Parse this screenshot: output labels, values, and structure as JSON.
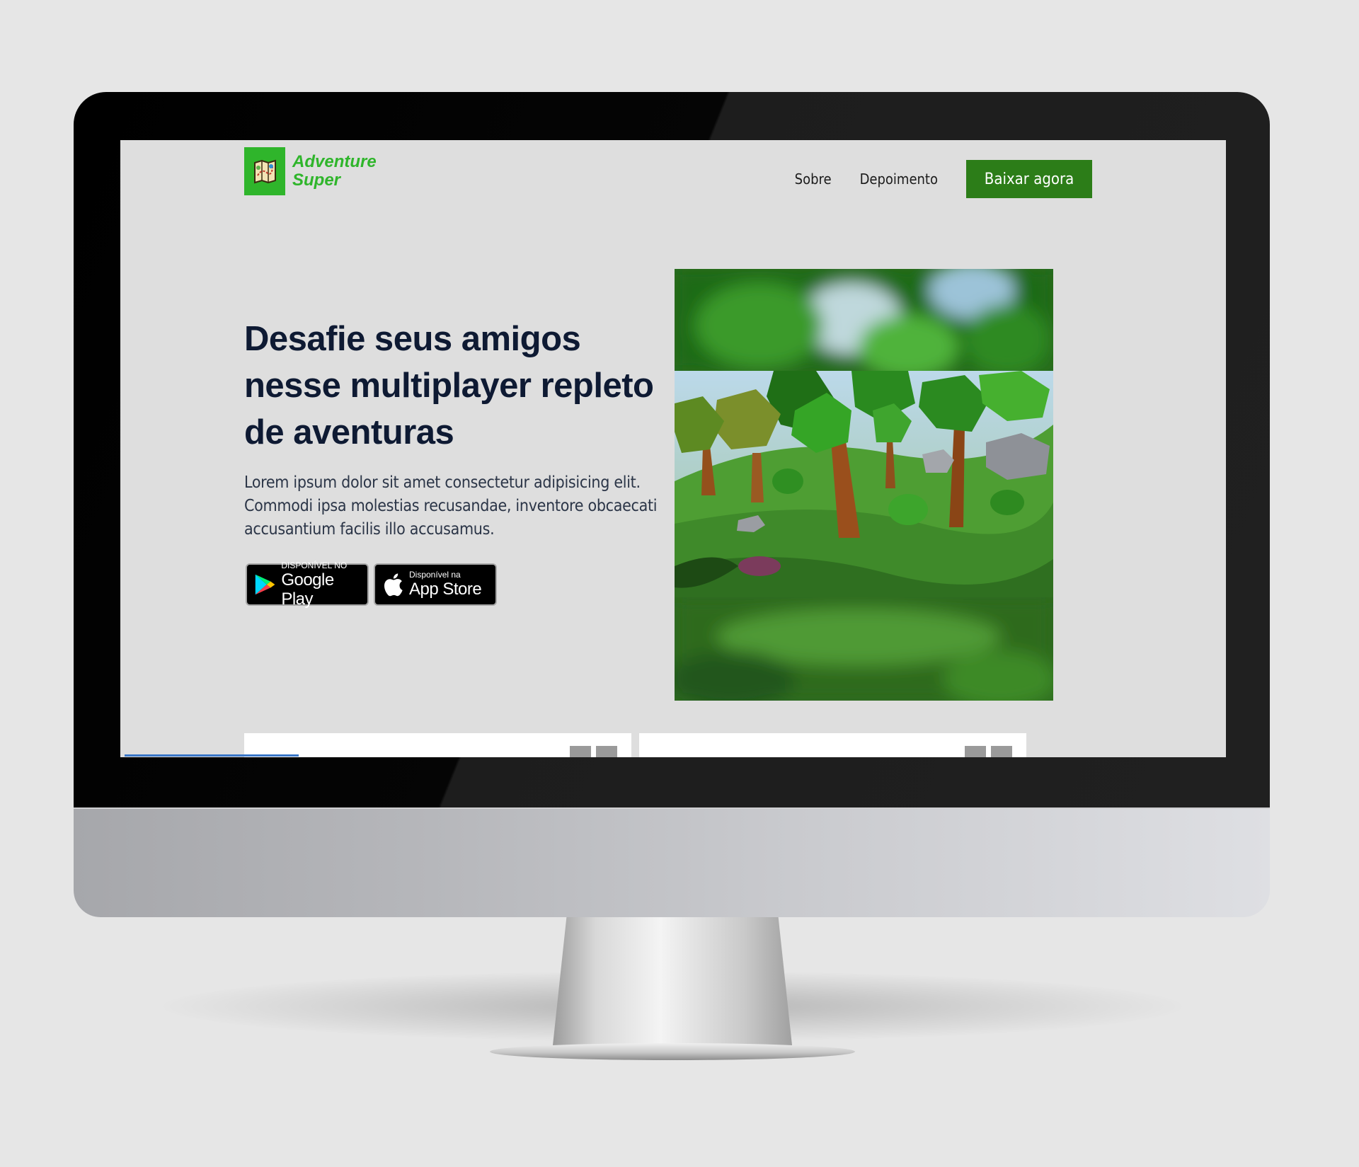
{
  "brand": {
    "name_line1": "Adventure",
    "name_line2": "Super",
    "color": "#2fb52b"
  },
  "nav": {
    "items": [
      {
        "label": "Sobre"
      },
      {
        "label": "Depoimento"
      }
    ],
    "cta_label": "Baixar agora",
    "cta_color": "#2c7d18"
  },
  "hero": {
    "headline": "Desafie seus amigos nesse multiplayer repleto de aventuras",
    "body": "Lorem ipsum dolor sit amet consectetur adipisicing elit. Commodi ipsa molestias recusandae, inventore obcaecati accusantium facilis illo accusamus."
  },
  "stores": {
    "google": {
      "small": "DISPONÍVEL NO",
      "big": "Google Play",
      "icon": "google-play-icon"
    },
    "apple": {
      "small": "Disponível na",
      "big": "App Store",
      "icon": "apple-icon"
    }
  }
}
